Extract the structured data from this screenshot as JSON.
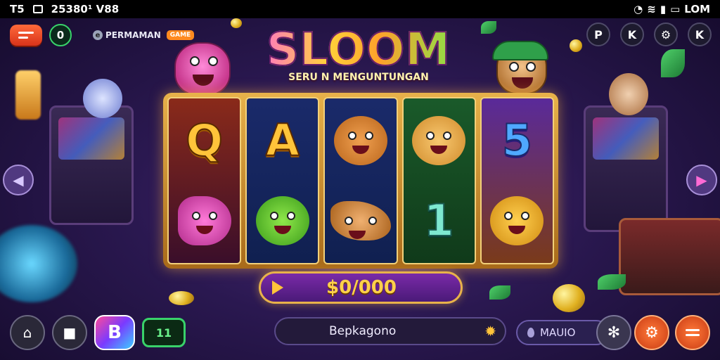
{
  "status_bar": {
    "left_text": "T5",
    "center_text": "25380¹ V88",
    "right_text": "LOM"
  },
  "top_left": {
    "menu_icon": "hamburger-icon",
    "counter": "0",
    "player_name": "PERMAMAN",
    "player_tag": "GAME"
  },
  "top_right": {
    "icons": [
      "pause-icon",
      "share-icon",
      "gear-icon",
      "close-icon"
    ],
    "labels": [
      "P",
      "K",
      "⚙",
      "K"
    ]
  },
  "logo": {
    "title": "SLOOM",
    "tagline": "SERU N MENGUNTUNGAN"
  },
  "reels": [
    {
      "top": {
        "kind": "letter",
        "value": "Q",
        "style": "gold"
      },
      "bottom": {
        "kind": "critter",
        "name": "pink-fish-symbol"
      }
    },
    {
      "top": {
        "kind": "letter",
        "value": "A",
        "style": "gold"
      },
      "bottom": {
        "kind": "critter",
        "name": "green-critter-symbol"
      }
    },
    {
      "top": {
        "kind": "critter",
        "name": "bear-symbol"
      },
      "bottom": {
        "kind": "critter",
        "name": "sack-symbol"
      }
    },
    {
      "top": {
        "kind": "critter",
        "name": "fox-symbol"
      },
      "bottom": {
        "kind": "letter",
        "value": "1",
        "style": "teal"
      }
    },
    {
      "top": {
        "kind": "letter",
        "value": "5",
        "style": "blue"
      },
      "bottom": {
        "kind": "critter",
        "name": "cat-symbol"
      }
    }
  ],
  "navigation": {
    "prev_icon": "chevron-left-icon",
    "next_icon": "chevron-right-icon",
    "prev_glyph": "◀",
    "next_glyph": "▶"
  },
  "spin": {
    "play_icon": "play-icon",
    "value": "$0/000"
  },
  "bottom_left": {
    "home_icon": "home-icon",
    "bag_icon": "bag-icon",
    "b_label": "B",
    "level": "11"
  },
  "search": {
    "value": "Bepkagono",
    "icon": "gear-icon"
  },
  "balance": {
    "icon": "drop-icon",
    "value": "MAUIO"
  },
  "bottom_right": {
    "icons": [
      "spark-icon",
      "gear-icon",
      "hamburger-icon"
    ]
  },
  "colors": {
    "accent_gold": "#ffc43a",
    "accent_orange": "#ff6a3a",
    "accent_green": "#39d26a",
    "bg_purple": "#2a1850"
  }
}
